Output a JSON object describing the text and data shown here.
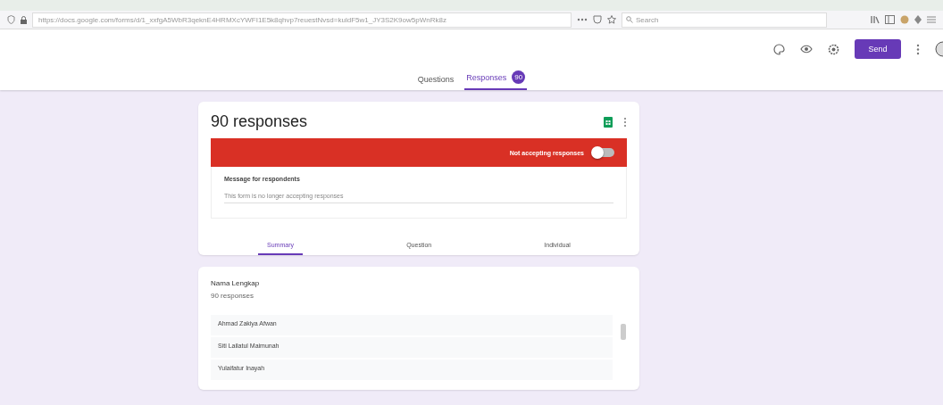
{
  "browser": {
    "url": "https://docs.google.com/forms/d/1_xxfgA5WbR3qeknE4HRMXcYWFI1E5k8qhvp7reuestNvsd=kuldF5w1_JY3S2K9ow5pWnRk8z",
    "search_placeholder": "Search"
  },
  "header": {
    "send_label": "Send"
  },
  "form_tabs": [
    {
      "label": "Questions",
      "selected": false
    },
    {
      "label": "Responses",
      "badge": "90",
      "selected": true
    }
  ],
  "summary_card": {
    "title": "90 responses",
    "accepting": {
      "label": "Not accepting responses",
      "on": false
    },
    "message": {
      "label": "Message for respondents",
      "value": "This form is no longer accepting responses"
    },
    "view_tabs": [
      {
        "label": "Summary",
        "selected": true
      },
      {
        "label": "Question",
        "selected": false
      },
      {
        "label": "Individual",
        "selected": false
      }
    ]
  },
  "question_card": {
    "title": "Nama Lengkap",
    "count": "90 responses",
    "answers": [
      "Ahmad Zakiya Afwan",
      "Siti Lailatul Maimunah",
      "Yulaifatur Inayah"
    ]
  }
}
